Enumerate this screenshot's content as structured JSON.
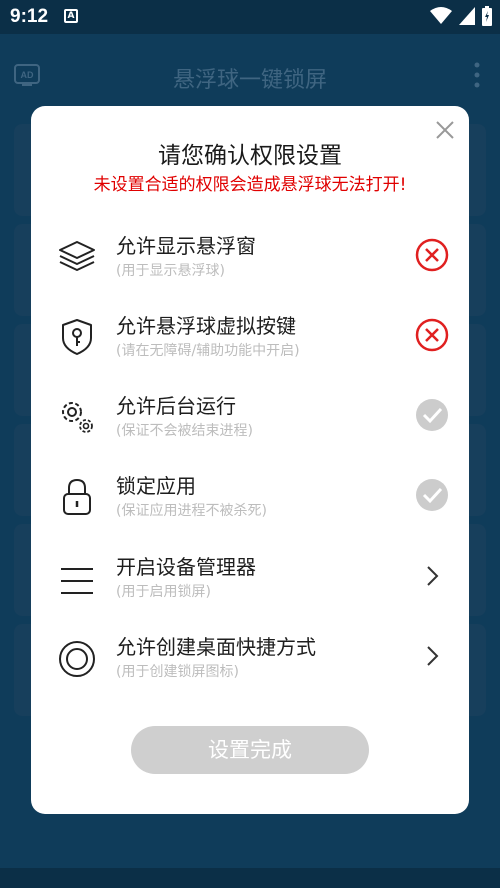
{
  "status": {
    "time": "9:12",
    "notification_glyph": "A"
  },
  "app": {
    "title": "悬浮球一键锁屏"
  },
  "dialog": {
    "title": "请您确认权限设置",
    "warning": "未设置合适的权限会造成悬浮球无法打开!",
    "permissions": [
      {
        "title": "允许显示悬浮窗",
        "subtitle": "(用于显示悬浮球)",
        "icon": "layers-icon",
        "status": "denied"
      },
      {
        "title": "允许悬浮球虚拟按键",
        "subtitle": "(请在无障碍/辅助功能中开启)",
        "icon": "shield-key-icon",
        "status": "denied"
      },
      {
        "title": "允许后台运行",
        "subtitle": "(保证不会被结束进程)",
        "icon": "gears-icon",
        "status": "granted"
      },
      {
        "title": "锁定应用",
        "subtitle": "(保证应用进程不被杀死)",
        "icon": "lock-icon",
        "status": "granted"
      },
      {
        "title": "开启设备管理器",
        "subtitle": "(用于启用锁屏)",
        "icon": "menu-lines-icon",
        "status": "navigate"
      },
      {
        "title": "允许创建桌面快捷方式",
        "subtitle": "(用于创建锁屏图标)",
        "icon": "circle-ring-icon",
        "status": "navigate"
      }
    ],
    "done_label": "设置完成"
  },
  "colors": {
    "denied": "#e02020",
    "granted": "#cccccc",
    "warning": "#e00000",
    "dim_background": "#0f3c5a"
  }
}
